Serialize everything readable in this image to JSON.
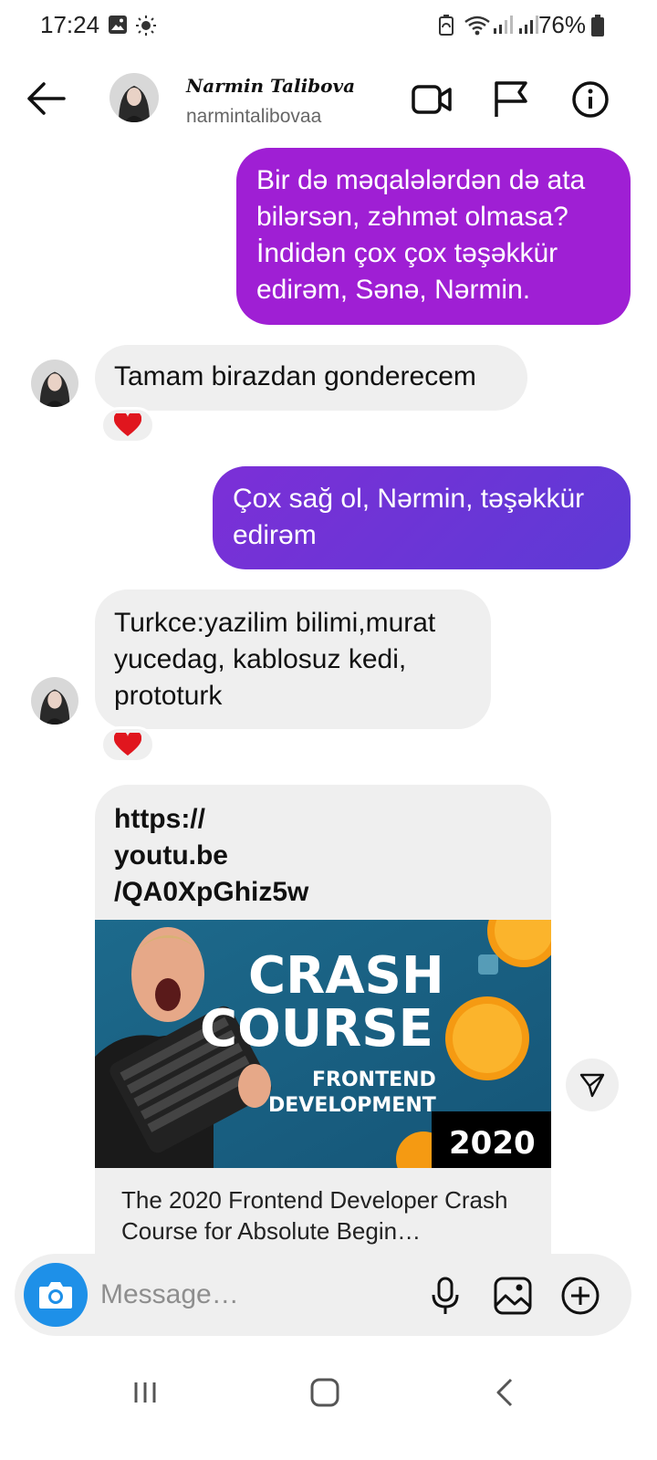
{
  "status_bar": {
    "time": "17:24",
    "battery": "76%",
    "icons": [
      "gallery-icon",
      "brightness-icon",
      "battery-saver-icon",
      "wifi-icon",
      "signal-icon",
      "signal-icon",
      "battery-icon"
    ]
  },
  "header": {
    "display_name": "Narmin Talibova",
    "username": "narmintalibovaa",
    "icons": [
      "back-arrow-icon",
      "video-call-icon",
      "flag-icon",
      "info-icon"
    ]
  },
  "messages": [
    {
      "direction": "out",
      "text": "Bir də məqalələrdən də ata bilərsən, zəhmət olmasa? İndidən çox çox təşəkkür edirəm, Sənə, Nərmin.",
      "color": "#9f1fd4"
    },
    {
      "direction": "in",
      "text": "Tamam birazdan gonderecem",
      "reaction": "❤️"
    },
    {
      "direction": "out",
      "text": "Çox sağ ol, Nərmin, təşəkkür edirəm",
      "color": "#6a34d6"
    },
    {
      "direction": "in",
      "text": "Turkce:yazilim bilimi,murat yucedag,  kablosuz kedi, prototurk",
      "reaction": "❤️"
    }
  ],
  "link_preview": {
    "url": "https://\nyoutu.be\n/QA0XpGhiz5w",
    "thumbnail_line1": "CRASH",
    "thumbnail_line2": "COURSE",
    "thumbnail_line3": "FRONTEND",
    "thumbnail_line4": "DEVELOPMENT",
    "thumbnail_year": "2020",
    "title": "The 2020 Frontend Developer Crash Course for Absolute Begin…"
  },
  "composer": {
    "placeholder": "Message…",
    "accent": "#1e90e8",
    "icons": [
      "camera-icon",
      "microphone-icon",
      "image-icon",
      "plus-circle-icon"
    ]
  },
  "nav_bar": {
    "icons": [
      "recent-apps-icon",
      "home-icon",
      "back-icon"
    ]
  }
}
